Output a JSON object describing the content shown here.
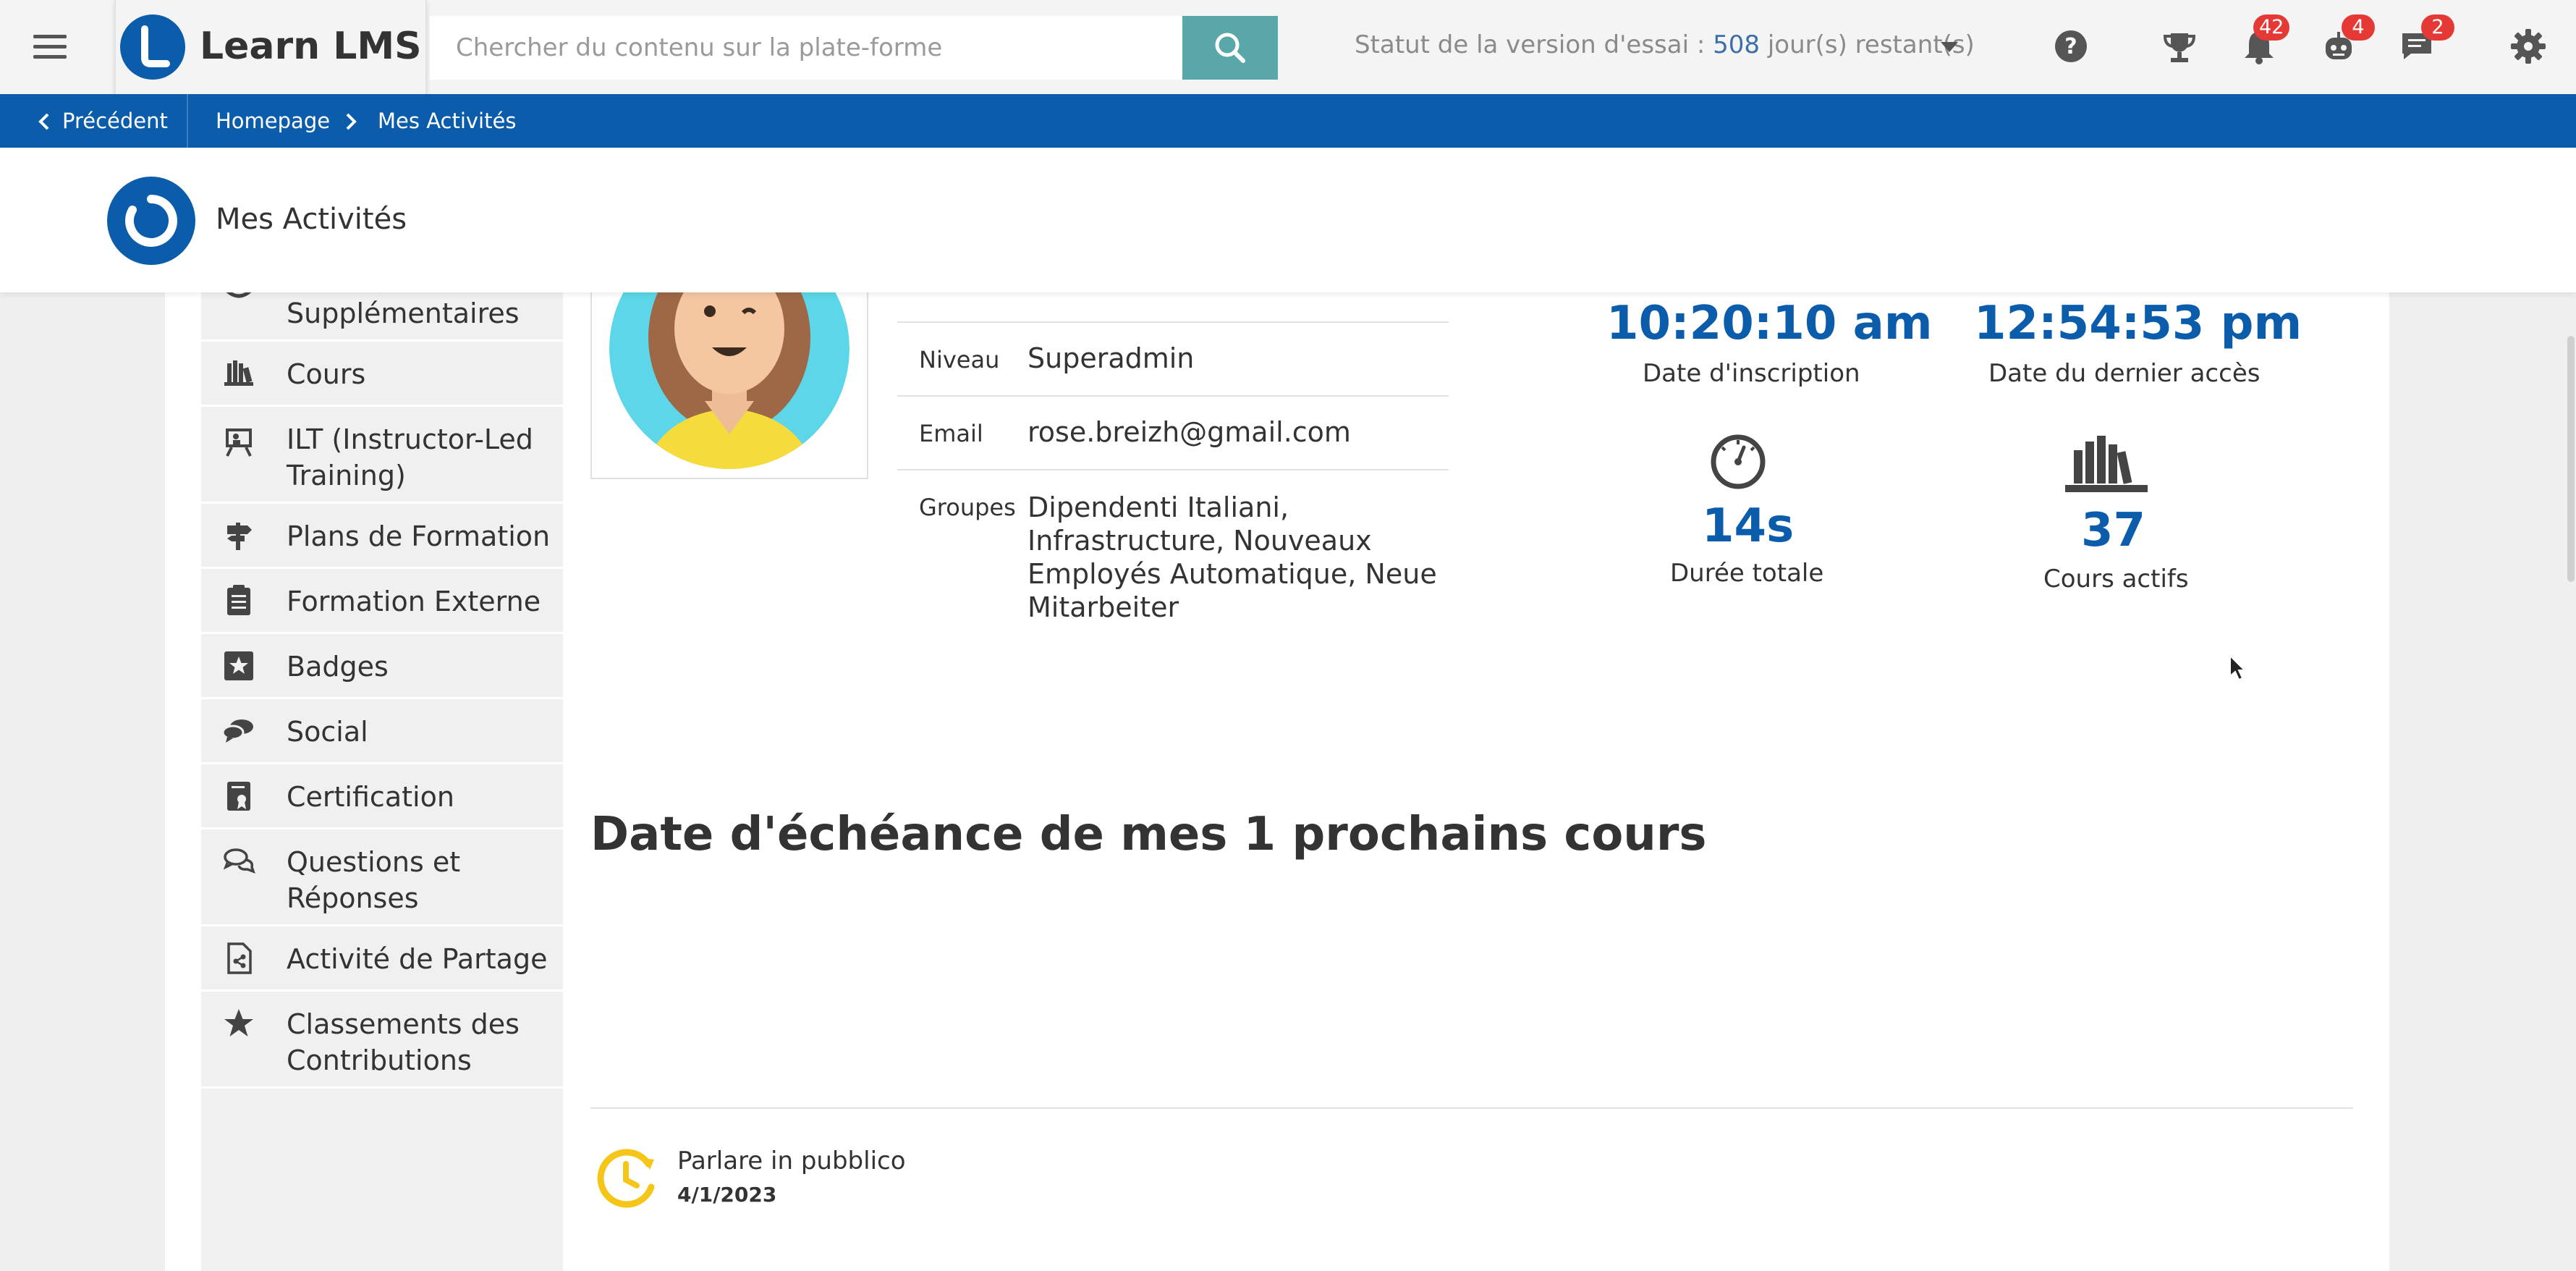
{
  "app": {
    "name": "Learn LMS"
  },
  "search": {
    "placeholder": "Chercher du contenu sur la plate-forme"
  },
  "trial": {
    "prefix": "Statut de la version d'essai : ",
    "days": "508",
    "suffix": " jour(s) restant(s)"
  },
  "notifications": {
    "bell_count": "42",
    "robot_count": "4",
    "chat_count": "2"
  },
  "breadcrumb": {
    "back_label": "Précédent",
    "items": [
      "Homepage",
      "Mes Activités"
    ]
  },
  "page": {
    "title": "Mes Activités"
  },
  "sidebar": {
    "items": [
      {
        "label": "Supplémentaires",
        "icon": "extra-icon"
      },
      {
        "label": "Cours",
        "icon": "courses-icon"
      },
      {
        "label": "ILT (Instructor-Led",
        "label2": "Training)",
        "icon": "ilt-icon"
      },
      {
        "label": "Plans de Formation",
        "icon": "signpost-icon"
      },
      {
        "label": "Formation Externe",
        "icon": "clipboard-icon"
      },
      {
        "label": "Badges",
        "icon": "star-badge-icon"
      },
      {
        "label": "Social",
        "icon": "chat-bubbles-icon"
      },
      {
        "label": "Certification",
        "icon": "certificate-icon"
      },
      {
        "label": "Questions et",
        "label2": "Réponses",
        "icon": "qa-icon"
      },
      {
        "label": "Activité de Partage",
        "icon": "share-document-icon"
      },
      {
        "label": "Classements des",
        "label2": "Contributions",
        "icon": "star-icon"
      }
    ]
  },
  "profile": {
    "level_label": "Niveau",
    "level_value": "Superadmin",
    "email_label": "Email",
    "email_value": "rose.breizh@gmail.com",
    "groups_label": "Groupes",
    "groups_lines": [
      "Dipendenti Italiani,",
      "Infrastructure, Nouveaux",
      "Employés Automatique, Neue",
      "Mitarbeiter"
    ]
  },
  "stats": {
    "registration_time": "10:20:10 am",
    "registration_label": "Date d'inscription",
    "last_access_time": "12:54:53 pm",
    "last_access_label": "Date du dernier accès",
    "total_duration": "14s",
    "total_duration_label": "Durée totale",
    "active_courses": "37",
    "active_courses_label": "Cours actifs"
  },
  "upcoming": {
    "title": "Date d'échéance de mes 1 prochains cours",
    "courses": [
      {
        "title": "Parlare in pubblico",
        "date": "4/1/2023"
      }
    ]
  },
  "colors": {
    "brand": "#0b5cab",
    "search_button": "#5aa7aa",
    "badge": "#e53935"
  }
}
